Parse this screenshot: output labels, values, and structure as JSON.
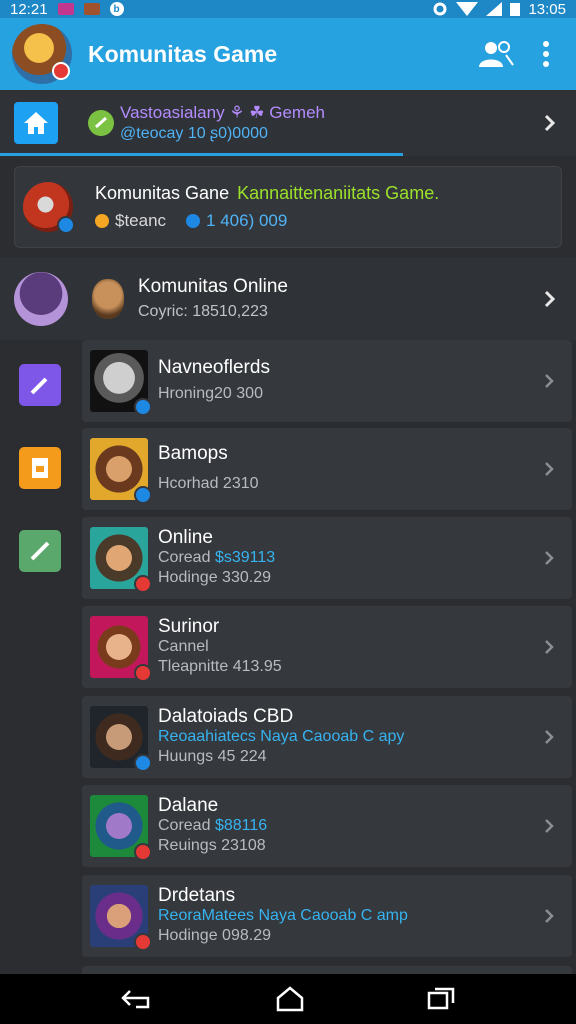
{
  "status": {
    "time_left": "12:21",
    "time_right": "13:05"
  },
  "app": {
    "title": "Komunitas Game",
    "accent": "#27a2e0"
  },
  "top_row": {
    "line1": "Vastoasialany ⚘ ☘ Gemeh",
    "line2": "@teocay 10 ʂ0)0000",
    "progress": 0.7
  },
  "featured": {
    "title": "Komunitas Gane",
    "title_green": "Kannaittenaniitats Game.",
    "sub_left": "$teanc",
    "sub_right": "1 406) 009"
  },
  "section": {
    "title": "Komunitas Online",
    "subtitle": "Coyric: 18510,223"
  },
  "left_icons": [
    "hand-icon",
    "orange-box-icon",
    "edit-icon"
  ],
  "items": [
    {
      "title": "Navneoflerds",
      "line1": "",
      "line1_blue": "",
      "line2": "Hroning20 300",
      "badge": "#1e88e5"
    },
    {
      "title": "Bamops",
      "line1": "",
      "line1_blue": "",
      "line2": "Hcorhad 2310",
      "badge": "#1e88e5"
    },
    {
      "title": "Online",
      "line1": "Coread",
      "line1_blue": "$s39113",
      "line2": "Hodinge 330.29",
      "badge": "#e53935"
    },
    {
      "title": "Surinor",
      "line1": "Cannel",
      "line1_blue": "",
      "line2": "Tleapnitte 413.95",
      "badge": "#e53935"
    },
    {
      "title": "Dalatoiads CBD",
      "line1": "",
      "line1_blue": "Reoaahiatecs Naya Caooab C apy",
      "line2": "Huungs 45 224",
      "badge": "#1e88e5"
    },
    {
      "title": "Dalane",
      "line1": "Coread",
      "line1_blue": "$88116",
      "line2": "Reuings 23108",
      "badge": "#e53935"
    },
    {
      "title": "Drdetans",
      "line1": "",
      "line1_blue": "ReoraMatees Naya Caooab C amp",
      "line2": "Hodinge 098.29",
      "badge": "#e53935"
    }
  ]
}
